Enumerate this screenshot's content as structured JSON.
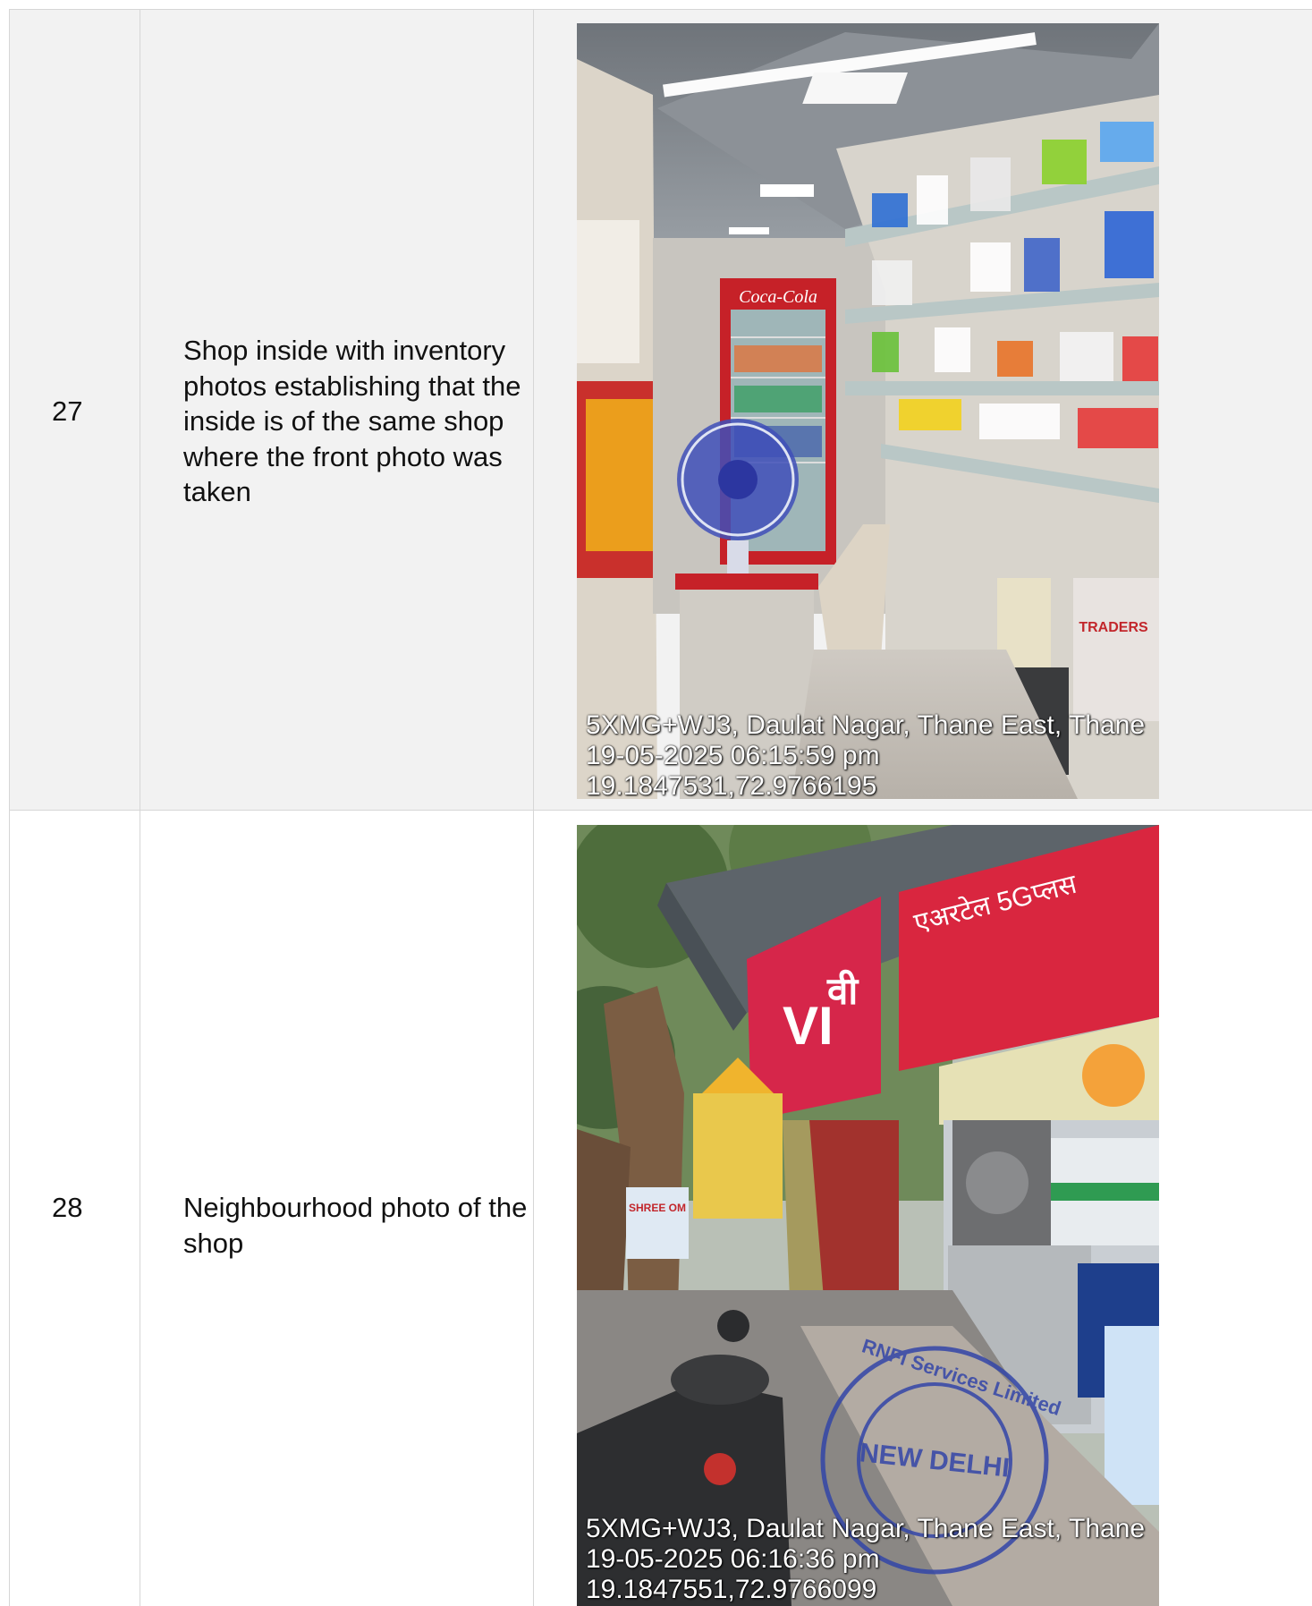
{
  "rows": [
    {
      "number": "27",
      "description": "Shop inside with inventory photos establishing that the inside is of the same shop where the front photo was taken",
      "photo": {
        "overlay": {
          "address": "5XMG+WJ3, Daulat Nagar, Thane East, Thane",
          "datetime": "19-05-2025 06:15:59 pm",
          "coords": "19.1847531,72.9766195"
        },
        "signage": [
          "Coca-Cola",
          "TRADERS"
        ]
      }
    },
    {
      "number": "28",
      "description": "Neighbourhood photo of the shop",
      "photo": {
        "overlay": {
          "address": "5XMG+WJ3, Daulat Nagar, Thane East, Thane",
          "datetime": "19-05-2025 06:16:36 pm",
          "coords": "19.1847551,72.9766099"
        },
        "signage": [
          "VI",
          "वी",
          "एअरटेल 5Gप्लस",
          "SHREE OM"
        ],
        "stamp": {
          "text": "RNFI Services Limited",
          "city": "NEW DELHI"
        }
      }
    }
  ]
}
